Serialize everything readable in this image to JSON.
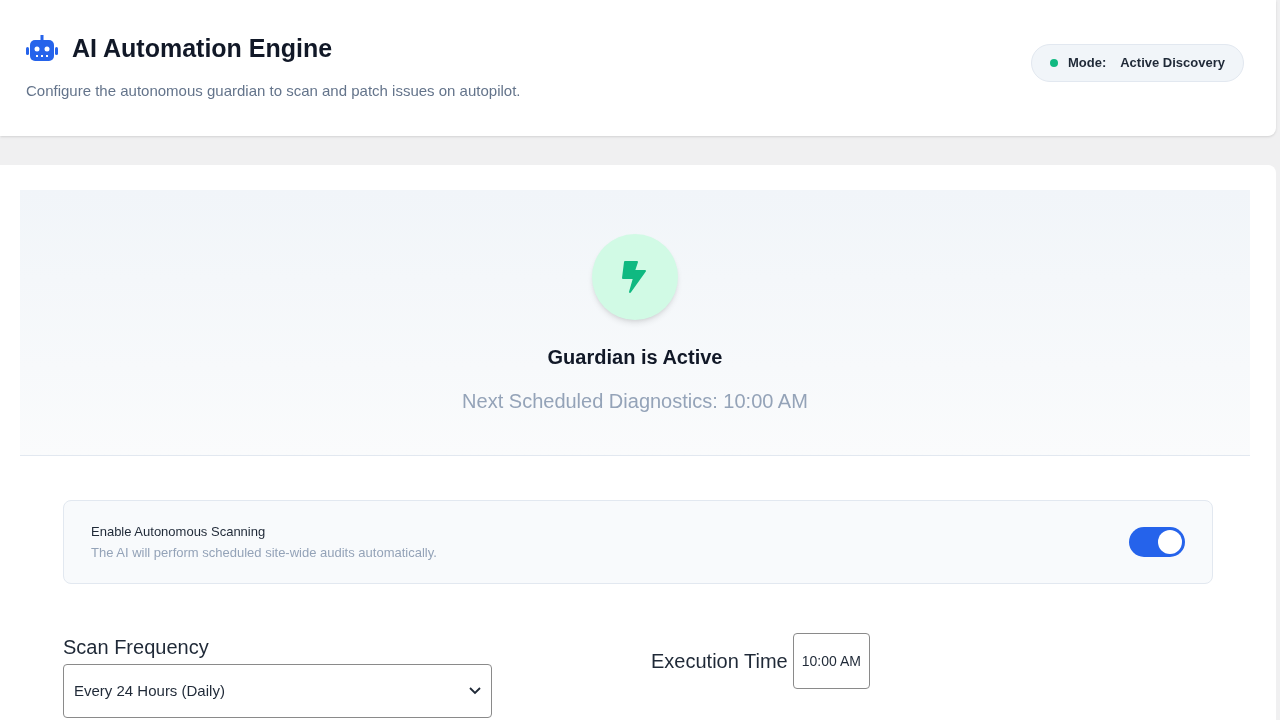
{
  "header": {
    "title": "AI Automation Engine",
    "subtitle": "Configure the autonomous guardian to scan and patch issues on autopilot.",
    "mode": {
      "label": "Mode:",
      "value": "Active Discovery",
      "color": "#10b981"
    }
  },
  "status": {
    "title": "Guardian is Active",
    "next_run": "Next Scheduled Diagnostics: 10:00 AM"
  },
  "autonomous_scanning": {
    "label": "Enable Autonomous Scanning",
    "description": "The AI will perform scheduled site-wide audits automatically.",
    "on": true
  },
  "scan_frequency": {
    "label": "Scan Frequency",
    "value": "Every 24 Hours (Daily)"
  },
  "execution_time": {
    "label": "Execution Time",
    "value": "10:00 AM"
  }
}
